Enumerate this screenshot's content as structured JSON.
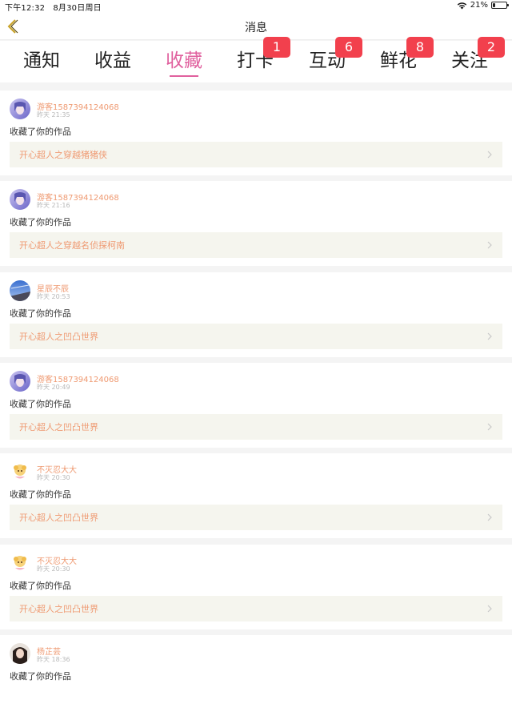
{
  "status_bar": {
    "time": "下午12:32",
    "date": "8月30日周日",
    "battery_percent": "21%",
    "battery_level": 0.21
  },
  "nav": {
    "title": "消息",
    "back_icon": "chevron-left-icon"
  },
  "tabs": [
    {
      "label": "通知",
      "badge": ""
    },
    {
      "label": "收益",
      "badge": ""
    },
    {
      "label": "收藏",
      "badge": "",
      "active": true
    },
    {
      "label": "打卡",
      "badge": "1"
    },
    {
      "label": "互动",
      "badge": "6"
    },
    {
      "label": "鲜花",
      "badge": "8"
    },
    {
      "label": "关注",
      "badge": "2"
    }
  ],
  "colors": {
    "accent": "#e0609e",
    "badge": "#f2404d",
    "name": "#ef9a72",
    "card_bg": "#f5f5ee"
  },
  "items": [
    {
      "user": "游客1587394124068",
      "time": "昨天 21:35",
      "action": "收藏了你的作品",
      "work": "开心超人之穿越猪猪侠",
      "avatar": "anime-girl-avatar"
    },
    {
      "user": "游客1587394124068",
      "time": "昨天 21:16",
      "action": "收藏了你的作品",
      "work": "开心超人之穿越名侦探柯南",
      "avatar": "anime-girl-avatar"
    },
    {
      "user": "星辰不辰",
      "time": "昨天 20:53",
      "action": "收藏了你的作品",
      "work": "开心超人之凹凸世界",
      "avatar": "sky-avatar"
    },
    {
      "user": "游客1587394124068",
      "time": "昨天 20:49",
      "action": "收藏了你的作品",
      "work": "开心超人之凹凸世界",
      "avatar": "anime-girl-avatar"
    },
    {
      "user": "不灭忍大大",
      "time": "昨天 20:30",
      "action": "收藏了你的作品",
      "work": "开心超人之凹凸世界",
      "avatar": "cartoon-avatar"
    },
    {
      "user": "不灭忍大大",
      "time": "昨天 20:30",
      "action": "收藏了你的作品",
      "work": "开心超人之凹凸世界",
      "avatar": "cartoon-avatar"
    },
    {
      "user": "杨芷芸",
      "time": "昨天 18:36",
      "action": "收藏了你的作品",
      "work": "",
      "avatar": "dark-hair-avatar"
    }
  ]
}
